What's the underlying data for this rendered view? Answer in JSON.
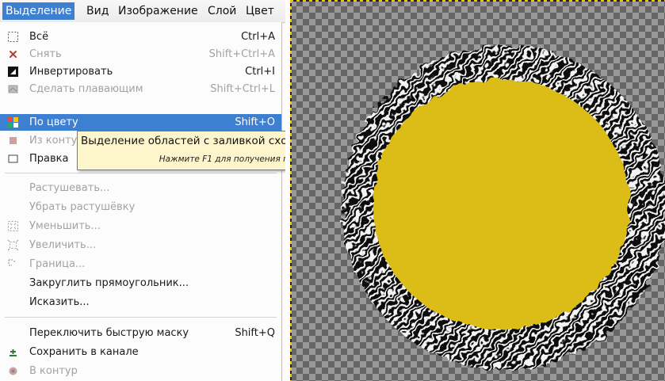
{
  "menubar": {
    "items": [
      {
        "label": "Выделение",
        "active": true
      },
      {
        "label": "Вид",
        "active": false
      },
      {
        "label": "Изображение",
        "active": false
      },
      {
        "label": "Слой",
        "active": false
      },
      {
        "label": "Цвет",
        "active": false
      }
    ]
  },
  "menu": {
    "items": [
      {
        "label": "Всё",
        "shortcut": "Ctrl+A",
        "icon": "select-all-icon",
        "enabled": true
      },
      {
        "label": "Снять",
        "shortcut": "Shift+Ctrl+A",
        "icon": "select-none-icon",
        "enabled": false
      },
      {
        "label": "Инвертировать",
        "shortcut": "Ctrl+I",
        "icon": "invert-selection-icon",
        "enabled": true
      },
      {
        "label": "Сделать плавающим",
        "shortcut": "Shift+Ctrl+L",
        "icon": "float-selection-icon",
        "enabled": false
      },
      {
        "label": "По цвету",
        "shortcut": "Shift+O",
        "icon": "select-by-color-icon",
        "enabled": true,
        "highlighted": true
      },
      {
        "label": "Из конту",
        "shortcut": "",
        "icon": "from-path-icon",
        "enabled": false
      },
      {
        "label": "Правка",
        "shortcut": "",
        "icon": "selection-editor-icon",
        "enabled": true
      },
      {
        "label": "Растушевать...",
        "shortcut": "",
        "icon": "",
        "enabled": false
      },
      {
        "label": "Убрать растушёвку",
        "shortcut": "",
        "icon": "",
        "enabled": false
      },
      {
        "label": "Уменьшить...",
        "shortcut": "",
        "icon": "shrink-selection-icon",
        "enabled": false
      },
      {
        "label": "Увеличить...",
        "shortcut": "",
        "icon": "grow-selection-icon",
        "enabled": false
      },
      {
        "label": "Граница...",
        "shortcut": "",
        "icon": "border-selection-icon",
        "enabled": false
      },
      {
        "label": "Закруглить прямоугольник...",
        "shortcut": "",
        "icon": "",
        "enabled": true
      },
      {
        "label": "Исказить...",
        "shortcut": "",
        "icon": "",
        "enabled": true
      },
      {
        "label": "Переключить быструю маску",
        "shortcut": "Shift+Q",
        "icon": "",
        "enabled": true
      },
      {
        "label": "Сохранить в канале",
        "shortcut": "",
        "icon": "save-to-channel-icon",
        "enabled": true
      },
      {
        "label": "В контур",
        "shortcut": "",
        "icon": "to-path-icon",
        "enabled": false
      }
    ]
  },
  "tooltip": {
    "text": "Выделение областей с заливкой схо",
    "hint": "Нажмите F1 для получения п"
  },
  "canvas": {
    "fill_color": "#dcbc14",
    "checker_light": "#999999",
    "checker_dark": "#666666",
    "selection_border_color": "#f4c400"
  }
}
